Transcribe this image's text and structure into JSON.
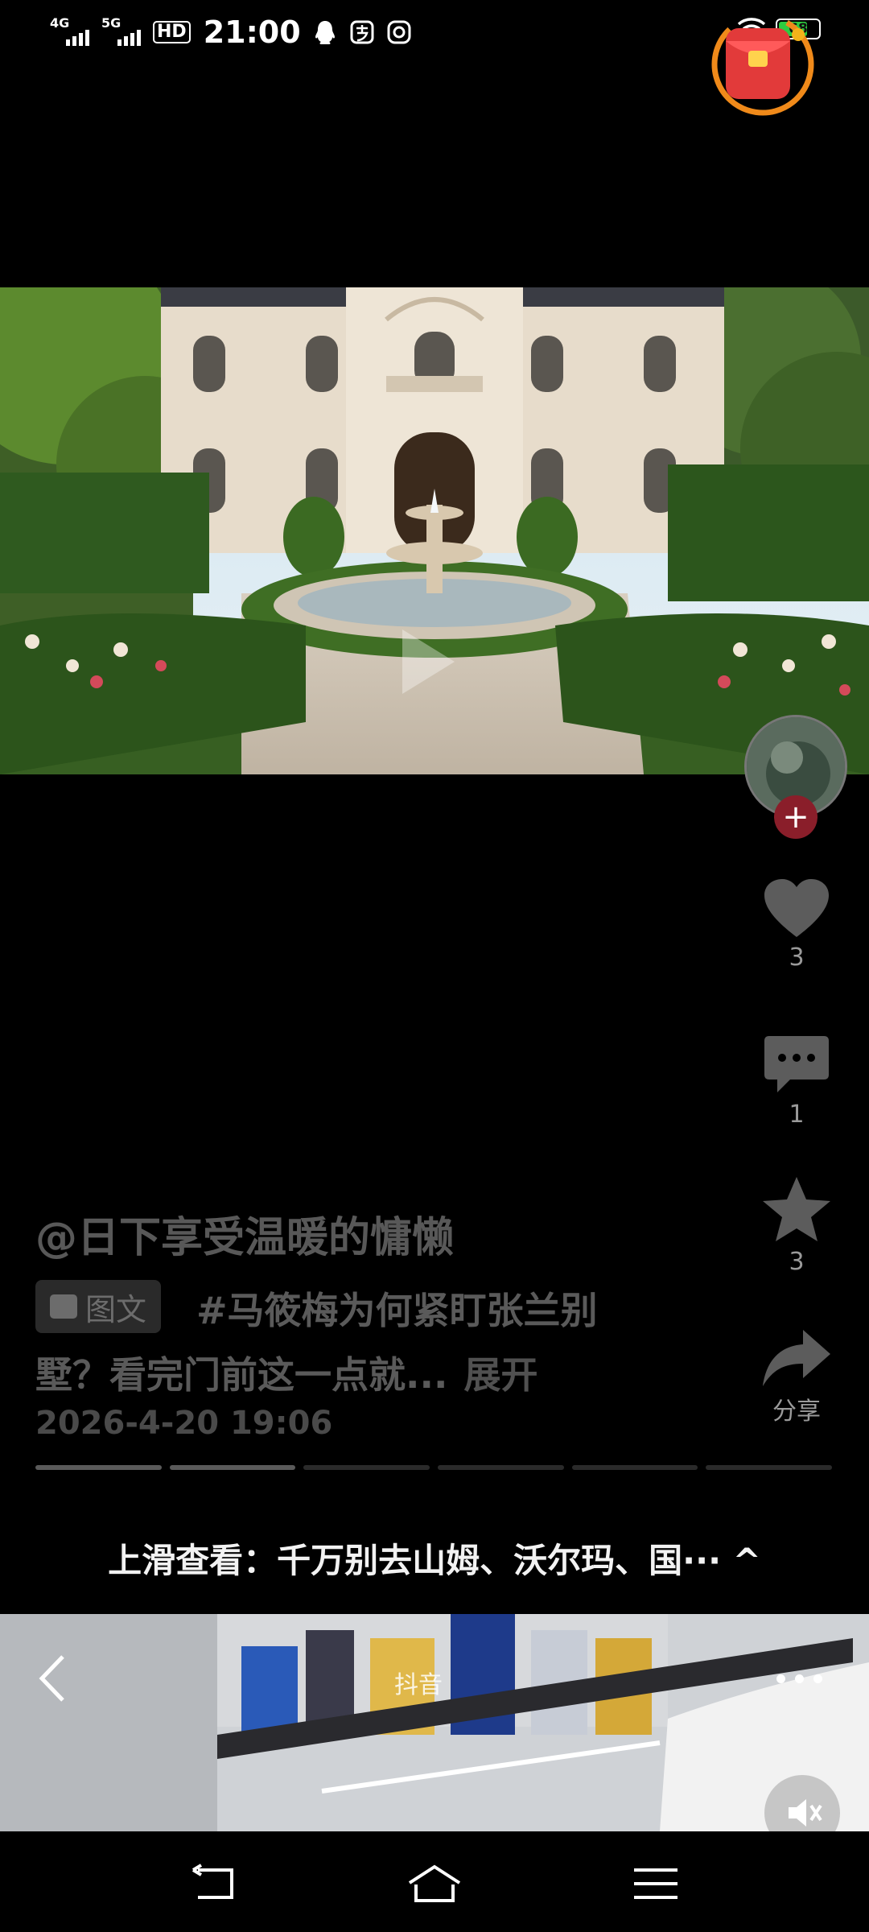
{
  "status_bar": {
    "net1": "4G",
    "net2": "5G",
    "hd": "HD",
    "time": "21:00",
    "battery": "68"
  },
  "post": {
    "author": "@日下享受温暖的慵懒",
    "type_badge": "图文",
    "desc_line1": "#马筱梅为何紧盯张兰别",
    "desc_line2": "墅？看完门前这一点就...",
    "expand": "展开",
    "datetime": "2026-4-20  19:06",
    "slides_total": 6,
    "slides_viewed": 2
  },
  "rail": {
    "likes": "3",
    "comments": "1",
    "favorites": "3",
    "share": "分享"
  },
  "next_tip": "上滑查看：千万别去山姆、沃尔玛、国··· ^",
  "preview": {
    "watermark": "抖音"
  },
  "icons": [
    "signal-icon",
    "hd-icon",
    "qq-icon",
    "alipay-icon",
    "app-icon",
    "wifi-icon",
    "battery-icon",
    "heart-icon",
    "comment-icon",
    "star-icon",
    "share-icon",
    "back-icon",
    "more-icon",
    "mute-icon",
    "nav-back-icon",
    "nav-home-icon",
    "nav-menu-icon"
  ]
}
